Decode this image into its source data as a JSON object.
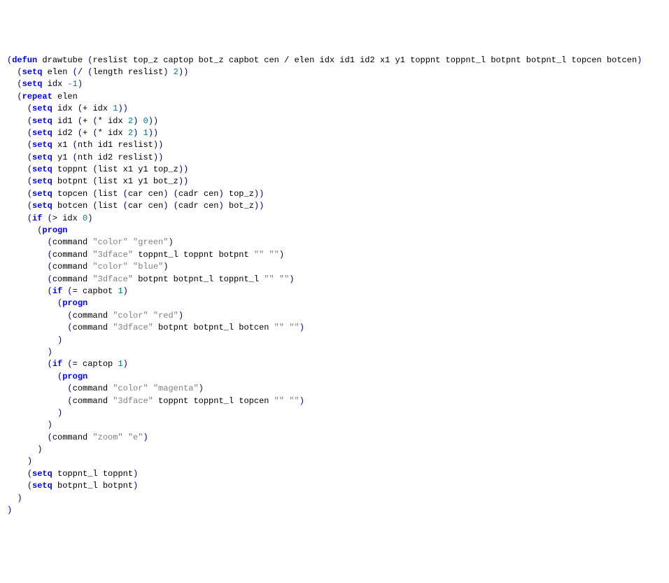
{
  "code": {
    "lines": [
      {
        "indent": 0,
        "tokens": [
          {
            "t": "p",
            "v": "("
          },
          {
            "t": "kw",
            "v": "defun"
          },
          {
            "t": "fn",
            "v": " drawtube "
          },
          {
            "t": "p",
            "v": "("
          },
          {
            "t": "fn",
            "v": "reslist top_z captop bot_z capbot cen / elen idx id1 id2 x1 y1 toppnt toppnt_l botpnt botpnt_l topcen botcen"
          },
          {
            "t": "p",
            "v": ")"
          }
        ]
      },
      {
        "indent": 1,
        "tokens": [
          {
            "t": "p",
            "v": "("
          },
          {
            "t": "kw",
            "v": "setq"
          },
          {
            "t": "fn",
            "v": " elen "
          },
          {
            "t": "p",
            "v": "("
          },
          {
            "t": "fn",
            "v": "/ "
          },
          {
            "t": "p",
            "v": "("
          },
          {
            "t": "fn",
            "v": "length reslist"
          },
          {
            "t": "p",
            "v": ")"
          },
          {
            "t": "fn",
            "v": " "
          },
          {
            "t": "nm",
            "v": "2"
          },
          {
            "t": "p",
            "v": "))"
          }
        ]
      },
      {
        "indent": 1,
        "tokens": [
          {
            "t": "p",
            "v": "("
          },
          {
            "t": "kw",
            "v": "setq"
          },
          {
            "t": "fn",
            "v": " idx "
          },
          {
            "t": "nm",
            "v": "-1"
          },
          {
            "t": "p",
            "v": ")"
          }
        ]
      },
      {
        "indent": 1,
        "tokens": [
          {
            "t": "p",
            "v": "("
          },
          {
            "t": "kw",
            "v": "repeat"
          },
          {
            "t": "fn",
            "v": " elen"
          }
        ]
      },
      {
        "indent": 2,
        "tokens": [
          {
            "t": "p",
            "v": "("
          },
          {
            "t": "kw",
            "v": "setq"
          },
          {
            "t": "fn",
            "v": " idx "
          },
          {
            "t": "p",
            "v": "("
          },
          {
            "t": "fn",
            "v": "+ idx "
          },
          {
            "t": "nm",
            "v": "1"
          },
          {
            "t": "p",
            "v": "))"
          }
        ]
      },
      {
        "indent": 2,
        "tokens": [
          {
            "t": "p",
            "v": "("
          },
          {
            "t": "kw",
            "v": "setq"
          },
          {
            "t": "fn",
            "v": " id1 "
          },
          {
            "t": "p",
            "v": "("
          },
          {
            "t": "fn",
            "v": "+ "
          },
          {
            "t": "p",
            "v": "("
          },
          {
            "t": "fn",
            "v": "* idx "
          },
          {
            "t": "nm",
            "v": "2"
          },
          {
            "t": "p",
            "v": ")"
          },
          {
            "t": "fn",
            "v": " "
          },
          {
            "t": "nm",
            "v": "0"
          },
          {
            "t": "p",
            "v": "))"
          }
        ]
      },
      {
        "indent": 2,
        "tokens": [
          {
            "t": "p",
            "v": "("
          },
          {
            "t": "kw",
            "v": "setq"
          },
          {
            "t": "fn",
            "v": " id2 "
          },
          {
            "t": "p",
            "v": "("
          },
          {
            "t": "fn",
            "v": "+ "
          },
          {
            "t": "p",
            "v": "("
          },
          {
            "t": "fn",
            "v": "* idx "
          },
          {
            "t": "nm",
            "v": "2"
          },
          {
            "t": "p",
            "v": ")"
          },
          {
            "t": "fn",
            "v": " "
          },
          {
            "t": "nm",
            "v": "1"
          },
          {
            "t": "p",
            "v": "))"
          }
        ]
      },
      {
        "indent": 2,
        "tokens": [
          {
            "t": "p",
            "v": "("
          },
          {
            "t": "kw",
            "v": "setq"
          },
          {
            "t": "fn",
            "v": " x1 "
          },
          {
            "t": "p",
            "v": "("
          },
          {
            "t": "fn",
            "v": "nth id1 reslist"
          },
          {
            "t": "p",
            "v": "))"
          }
        ]
      },
      {
        "indent": 2,
        "tokens": [
          {
            "t": "p",
            "v": "("
          },
          {
            "t": "kw",
            "v": "setq"
          },
          {
            "t": "fn",
            "v": " y1 "
          },
          {
            "t": "p",
            "v": "("
          },
          {
            "t": "fn",
            "v": "nth id2 reslist"
          },
          {
            "t": "p",
            "v": "))"
          }
        ]
      },
      {
        "indent": 2,
        "tokens": [
          {
            "t": "p",
            "v": "("
          },
          {
            "t": "kw",
            "v": "setq"
          },
          {
            "t": "fn",
            "v": " toppnt "
          },
          {
            "t": "p",
            "v": "("
          },
          {
            "t": "fn",
            "v": "list x1 y1 top_z"
          },
          {
            "t": "p",
            "v": "))"
          }
        ]
      },
      {
        "indent": 2,
        "tokens": [
          {
            "t": "p",
            "v": "("
          },
          {
            "t": "kw",
            "v": "setq"
          },
          {
            "t": "fn",
            "v": " botpnt "
          },
          {
            "t": "p",
            "v": "("
          },
          {
            "t": "fn",
            "v": "list x1 y1 bot_z"
          },
          {
            "t": "p",
            "v": "))"
          }
        ]
      },
      {
        "indent": 0,
        "tokens": [
          {
            "t": "fn",
            "v": ""
          }
        ]
      },
      {
        "indent": 2,
        "tokens": [
          {
            "t": "p",
            "v": "("
          },
          {
            "t": "kw",
            "v": "setq"
          },
          {
            "t": "fn",
            "v": " topcen "
          },
          {
            "t": "p",
            "v": "("
          },
          {
            "t": "fn",
            "v": "list "
          },
          {
            "t": "p",
            "v": "("
          },
          {
            "t": "fn",
            "v": "car cen"
          },
          {
            "t": "p",
            "v": ")"
          },
          {
            "t": "fn",
            "v": " "
          },
          {
            "t": "p",
            "v": "("
          },
          {
            "t": "fn",
            "v": "cadr cen"
          },
          {
            "t": "p",
            "v": ")"
          },
          {
            "t": "fn",
            "v": " top_z"
          },
          {
            "t": "p",
            "v": "))"
          }
        ]
      },
      {
        "indent": 2,
        "tokens": [
          {
            "t": "p",
            "v": "("
          },
          {
            "t": "kw",
            "v": "setq"
          },
          {
            "t": "fn",
            "v": " botcen "
          },
          {
            "t": "p",
            "v": "("
          },
          {
            "t": "fn",
            "v": "list "
          },
          {
            "t": "p",
            "v": "("
          },
          {
            "t": "fn",
            "v": "car cen"
          },
          {
            "t": "p",
            "v": ")"
          },
          {
            "t": "fn",
            "v": " "
          },
          {
            "t": "p",
            "v": "("
          },
          {
            "t": "fn",
            "v": "cadr cen"
          },
          {
            "t": "p",
            "v": ")"
          },
          {
            "t": "fn",
            "v": " bot_z"
          },
          {
            "t": "p",
            "v": "))"
          }
        ]
      },
      {
        "indent": 0,
        "tokens": [
          {
            "t": "fn",
            "v": ""
          }
        ]
      },
      {
        "indent": 2,
        "tokens": [
          {
            "t": "p",
            "v": "("
          },
          {
            "t": "kw",
            "v": "if"
          },
          {
            "t": "fn",
            "v": " "
          },
          {
            "t": "p",
            "v": "("
          },
          {
            "t": "fn",
            "v": "> idx "
          },
          {
            "t": "nm",
            "v": "0"
          },
          {
            "t": "p",
            "v": ")"
          }
        ]
      },
      {
        "indent": 3,
        "tokens": [
          {
            "t": "p",
            "v": "("
          },
          {
            "t": "kw",
            "v": "progn"
          }
        ]
      },
      {
        "indent": 4,
        "tokens": [
          {
            "t": "p",
            "v": "("
          },
          {
            "t": "fn",
            "v": "command "
          },
          {
            "t": "st",
            "v": "\"color\""
          },
          {
            "t": "fn",
            "v": " "
          },
          {
            "t": "st",
            "v": "\"green\""
          },
          {
            "t": "p",
            "v": ")"
          }
        ]
      },
      {
        "indent": 4,
        "tokens": [
          {
            "t": "p",
            "v": "("
          },
          {
            "t": "fn",
            "v": "command "
          },
          {
            "t": "st",
            "v": "\"3dface\""
          },
          {
            "t": "fn",
            "v": " toppnt_l toppnt botpnt "
          },
          {
            "t": "st",
            "v": "\"\""
          },
          {
            "t": "fn",
            "v": " "
          },
          {
            "t": "st",
            "v": "\"\""
          },
          {
            "t": "p",
            "v": ")"
          }
        ]
      },
      {
        "indent": 4,
        "tokens": [
          {
            "t": "p",
            "v": "("
          },
          {
            "t": "fn",
            "v": "command "
          },
          {
            "t": "st",
            "v": "\"color\""
          },
          {
            "t": "fn",
            "v": " "
          },
          {
            "t": "st",
            "v": "\"blue\""
          },
          {
            "t": "p",
            "v": ")"
          }
        ]
      },
      {
        "indent": 4,
        "tokens": [
          {
            "t": "p",
            "v": "("
          },
          {
            "t": "fn",
            "v": "command "
          },
          {
            "t": "st",
            "v": "\"3dface\""
          },
          {
            "t": "fn",
            "v": " botpnt botpnt_l toppnt_l "
          },
          {
            "t": "st",
            "v": "\"\""
          },
          {
            "t": "fn",
            "v": " "
          },
          {
            "t": "st",
            "v": "\"\""
          },
          {
            "t": "p",
            "v": ")"
          }
        ]
      },
      {
        "indent": 4,
        "tokens": [
          {
            "t": "p",
            "v": "("
          },
          {
            "t": "kw",
            "v": "if"
          },
          {
            "t": "fn",
            "v": " "
          },
          {
            "t": "p",
            "v": "("
          },
          {
            "t": "fn",
            "v": "= capbot "
          },
          {
            "t": "nm",
            "v": "1"
          },
          {
            "t": "p",
            "v": ")"
          }
        ]
      },
      {
        "indent": 5,
        "tokens": [
          {
            "t": "p",
            "v": "("
          },
          {
            "t": "kw",
            "v": "progn"
          }
        ]
      },
      {
        "indent": 6,
        "tokens": [
          {
            "t": "p",
            "v": "("
          },
          {
            "t": "fn",
            "v": "command "
          },
          {
            "t": "st",
            "v": "\"color\""
          },
          {
            "t": "fn",
            "v": " "
          },
          {
            "t": "st",
            "v": "\"red\""
          },
          {
            "t": "p",
            "v": ")"
          }
        ]
      },
      {
        "indent": 6,
        "tokens": [
          {
            "t": "p",
            "v": "("
          },
          {
            "t": "fn",
            "v": "command "
          },
          {
            "t": "st",
            "v": "\"3dface\""
          },
          {
            "t": "fn",
            "v": " botpnt botpnt_l botcen "
          },
          {
            "t": "st",
            "v": "\"\""
          },
          {
            "t": "fn",
            "v": " "
          },
          {
            "t": "st",
            "v": "\"\""
          },
          {
            "t": "p",
            "v": ")"
          }
        ]
      },
      {
        "indent": 5,
        "tokens": [
          {
            "t": "p",
            "v": ")"
          }
        ]
      },
      {
        "indent": 4,
        "tokens": [
          {
            "t": "p",
            "v": ")"
          }
        ]
      },
      {
        "indent": 4,
        "tokens": [
          {
            "t": "p",
            "v": "("
          },
          {
            "t": "kw",
            "v": "if"
          },
          {
            "t": "fn",
            "v": " "
          },
          {
            "t": "p",
            "v": "("
          },
          {
            "t": "fn",
            "v": "= captop "
          },
          {
            "t": "nm",
            "v": "1"
          },
          {
            "t": "p",
            "v": ")"
          }
        ]
      },
      {
        "indent": 5,
        "tokens": [
          {
            "t": "p",
            "v": "("
          },
          {
            "t": "kw",
            "v": "progn"
          }
        ]
      },
      {
        "indent": 6,
        "tokens": [
          {
            "t": "p",
            "v": "("
          },
          {
            "t": "fn",
            "v": "command "
          },
          {
            "t": "st",
            "v": "\"color\""
          },
          {
            "t": "fn",
            "v": " "
          },
          {
            "t": "st",
            "v": "\"magenta\""
          },
          {
            "t": "p",
            "v": ")"
          }
        ]
      },
      {
        "indent": 6,
        "tokens": [
          {
            "t": "p",
            "v": "("
          },
          {
            "t": "fn",
            "v": "command "
          },
          {
            "t": "st",
            "v": "\"3dface\""
          },
          {
            "t": "fn",
            "v": " toppnt toppnt_l topcen "
          },
          {
            "t": "st",
            "v": "\"\""
          },
          {
            "t": "fn",
            "v": " "
          },
          {
            "t": "st",
            "v": "\"\""
          },
          {
            "t": "p",
            "v": ")"
          }
        ]
      },
      {
        "indent": 5,
        "tokens": [
          {
            "t": "p",
            "v": ")"
          }
        ]
      },
      {
        "indent": 4,
        "tokens": [
          {
            "t": "p",
            "v": ")"
          }
        ]
      },
      {
        "indent": 4,
        "tokens": [
          {
            "t": "p",
            "v": "("
          },
          {
            "t": "fn",
            "v": "command "
          },
          {
            "t": "st",
            "v": "\"zoom\""
          },
          {
            "t": "fn",
            "v": " "
          },
          {
            "t": "st",
            "v": "\"e\""
          },
          {
            "t": "p",
            "v": ")"
          }
        ]
      },
      {
        "indent": 3,
        "tokens": [
          {
            "t": "p",
            "v": ")"
          }
        ]
      },
      {
        "indent": 2,
        "tokens": [
          {
            "t": "p",
            "v": ")"
          }
        ]
      },
      {
        "indent": 2,
        "tokens": [
          {
            "t": "p",
            "v": "("
          },
          {
            "t": "kw",
            "v": "setq"
          },
          {
            "t": "fn",
            "v": " toppnt_l toppnt"
          },
          {
            "t": "p",
            "v": ")"
          }
        ]
      },
      {
        "indent": 2,
        "tokens": [
          {
            "t": "p",
            "v": "("
          },
          {
            "t": "kw",
            "v": "setq"
          },
          {
            "t": "fn",
            "v": " botpnt_l botpnt"
          },
          {
            "t": "p",
            "v": ")"
          }
        ]
      },
      {
        "indent": 1,
        "tokens": [
          {
            "t": "p",
            "v": ")"
          }
        ]
      },
      {
        "indent": 0,
        "tokens": [
          {
            "t": "p",
            "v": ")"
          }
        ]
      }
    ]
  }
}
